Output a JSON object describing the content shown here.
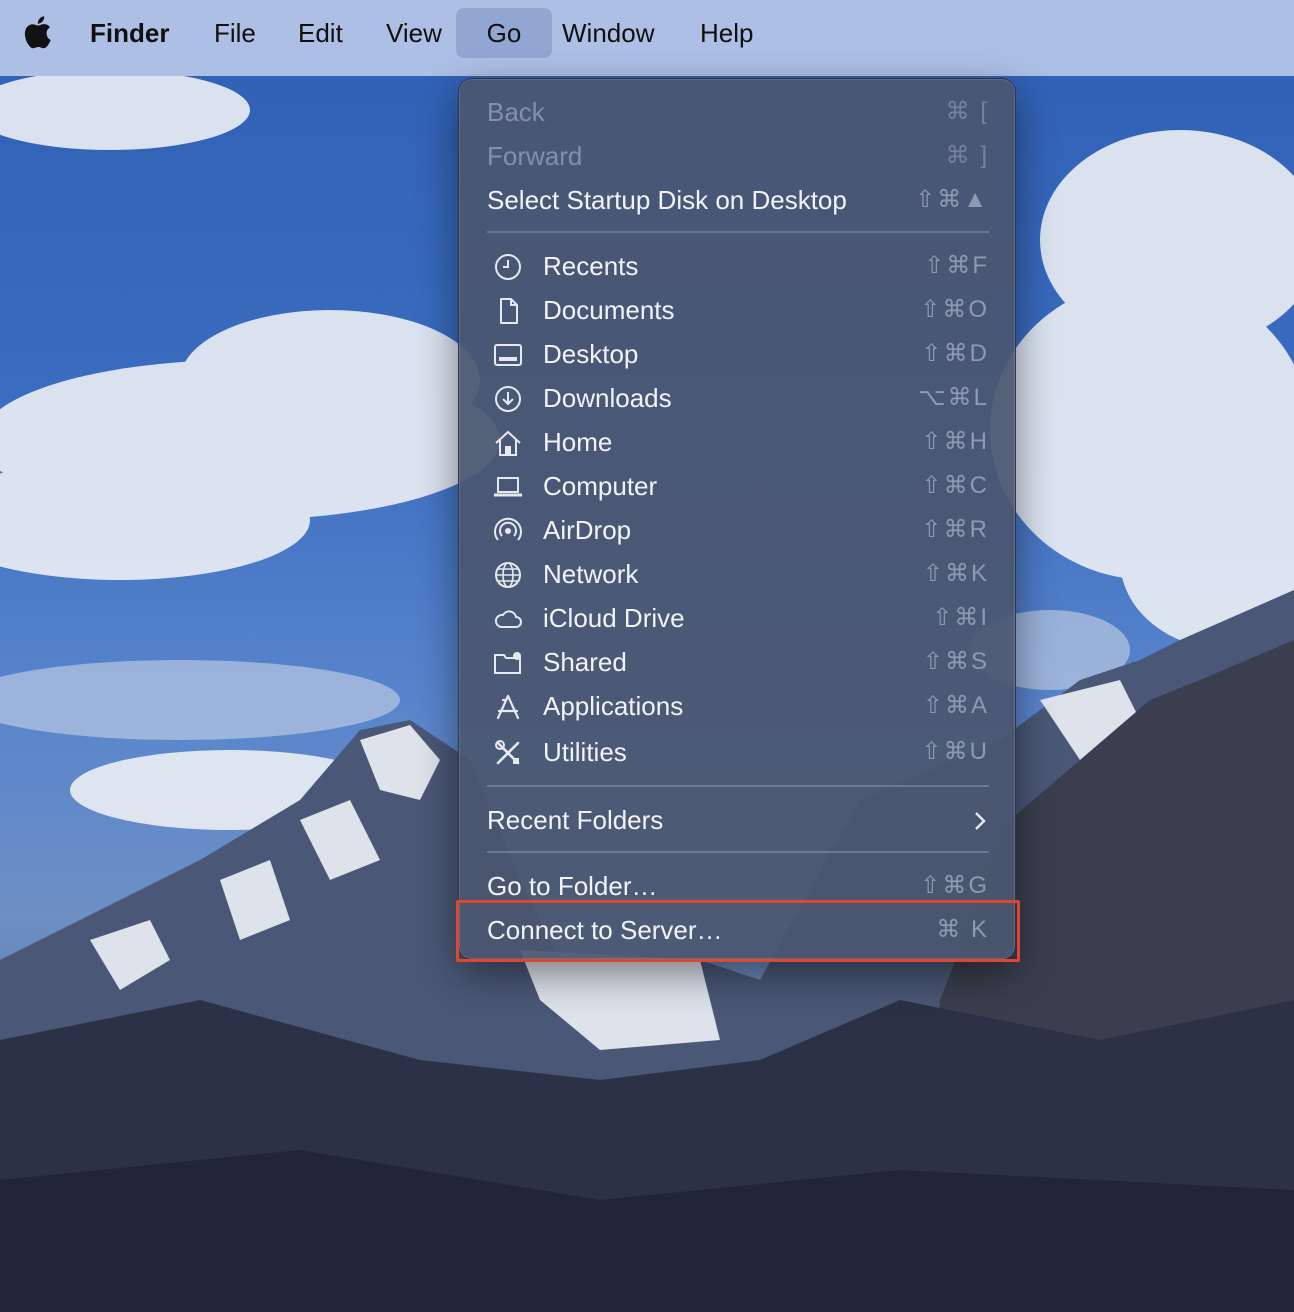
{
  "menubar": {
    "app_name": "Finder",
    "items": [
      "File",
      "Edit",
      "View",
      "Go",
      "Window",
      "Help"
    ],
    "active_item": "Go"
  },
  "go_menu": {
    "nav": [
      {
        "label": "Back",
        "shortcut": "⌘ [",
        "enabled": false
      },
      {
        "label": "Forward",
        "shortcut": "⌘ ]",
        "enabled": false
      },
      {
        "label": "Select Startup Disk on Desktop",
        "shortcut": "⇧⌘▲",
        "enabled": true
      }
    ],
    "places": [
      {
        "label": "Recents",
        "shortcut": "⇧⌘F",
        "icon": "clock-icon"
      },
      {
        "label": "Documents",
        "shortcut": "⇧⌘O",
        "icon": "document-icon"
      },
      {
        "label": "Desktop",
        "shortcut": "⇧⌘D",
        "icon": "desktop-icon"
      },
      {
        "label": "Downloads",
        "shortcut": "⌥⌘L",
        "icon": "download-icon"
      },
      {
        "label": "Home",
        "shortcut": "⇧⌘H",
        "icon": "home-icon"
      },
      {
        "label": "Computer",
        "shortcut": "⇧⌘C",
        "icon": "laptop-icon"
      },
      {
        "label": "AirDrop",
        "shortcut": "⇧⌘R",
        "icon": "airdrop-icon"
      },
      {
        "label": "Network",
        "shortcut": "⇧⌘K",
        "icon": "globe-icon"
      },
      {
        "label": "iCloud Drive",
        "shortcut": "⇧⌘I",
        "icon": "cloud-icon"
      },
      {
        "label": "Shared",
        "shortcut": "⇧⌘S",
        "icon": "shared-folder-icon"
      },
      {
        "label": "Applications",
        "shortcut": "⇧⌘A",
        "icon": "applications-icon"
      },
      {
        "label": "Utilities",
        "shortcut": "⇧⌘U",
        "icon": "utilities-icon"
      }
    ],
    "recent_folders": {
      "label": "Recent Folders",
      "icon": "chevron-right-icon"
    },
    "go_to_folder": {
      "label": "Go to Folder…",
      "shortcut": "⇧⌘G"
    },
    "connect_to_server": {
      "label": "Connect to Server…",
      "shortcut": "⌘ K",
      "highlighted": true
    }
  },
  "colors": {
    "menubar_bg": "#aebfe6",
    "menu_bg": "#4a5670",
    "highlight_border": "#e0452d"
  }
}
